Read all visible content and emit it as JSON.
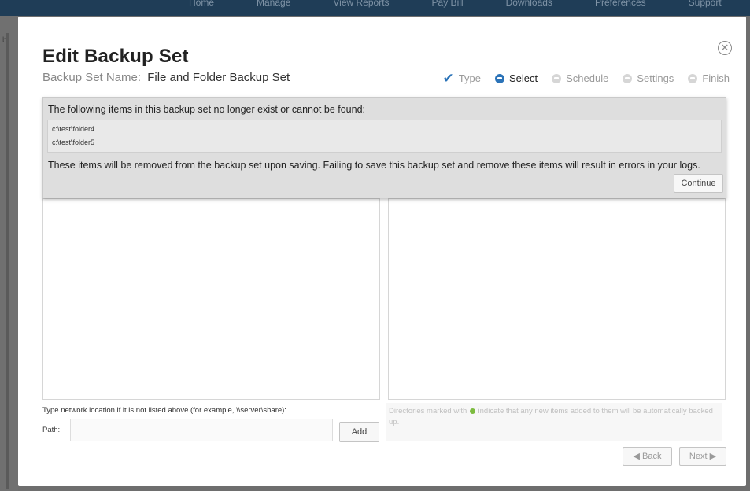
{
  "app": {
    "nav": [
      "Home",
      "Manage",
      "View Reports",
      "Pay Bill",
      "Downloads",
      "Preferences",
      "Support"
    ],
    "side_char": "b"
  },
  "dialog": {
    "title": "Edit Backup Set",
    "set_name_label": "Backup Set Name:",
    "set_name_value": "File and Folder Backup Set",
    "close_glyph": "✕",
    "steps": [
      {
        "label": "Type",
        "state": "done"
      },
      {
        "label": "Select",
        "state": "current"
      },
      {
        "label": "Schedule",
        "state": "pending"
      },
      {
        "label": "Settings",
        "state": "pending"
      },
      {
        "label": "Finish",
        "state": "pending"
      }
    ]
  },
  "alert": {
    "message": "The following items in this backup set no longer exist or cannot be found:",
    "items": [
      "c:\\test\\folder4",
      "c:\\test\\folder5"
    ],
    "warning": "These items will be removed from the backup set upon saving. Failing to save this backup set and remove these items will result in errors in your logs.",
    "continue_label": "Continue"
  },
  "network": {
    "label": "Type network location if it is not listed above (for example, \\\\server\\share):",
    "path_label": "Path:",
    "path_value": "",
    "add_label": "Add"
  },
  "hint": {
    "before_icon": "Directories marked with",
    "after_icon": "indicate that any new items added to them will be automatically backed up."
  },
  "footer": {
    "back_label": "Back",
    "next_label": "Next"
  },
  "colors": {
    "accent": "#2b73b8",
    "auto_backup_dot": "#7cbb3f"
  }
}
